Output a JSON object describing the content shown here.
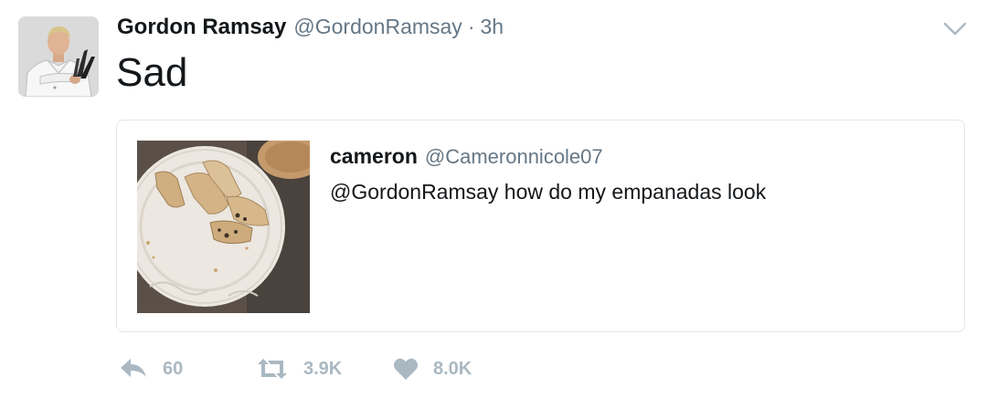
{
  "tweet": {
    "author_name": "Gordon Ramsay",
    "author_handle": "@GordonRamsay",
    "separator": "·",
    "time": "3h",
    "text": "Sad",
    "avatar_icon": "chef-with-knives-avatar"
  },
  "quoted_tweet": {
    "author_name": "cameron",
    "author_handle": "@Cameronnicole07",
    "text": "@GordonRamsay how do my empanadas look",
    "media_icon": "empanadas-on-plate-photo"
  },
  "actions": {
    "reply_count": "60",
    "retweet_count": "3.9K",
    "like_count": "8.0K"
  },
  "colors": {
    "text_primary": "#14171a",
    "text_secondary": "#657786",
    "action_gray": "#aab8c2",
    "card_border": "#e1e8ed"
  }
}
